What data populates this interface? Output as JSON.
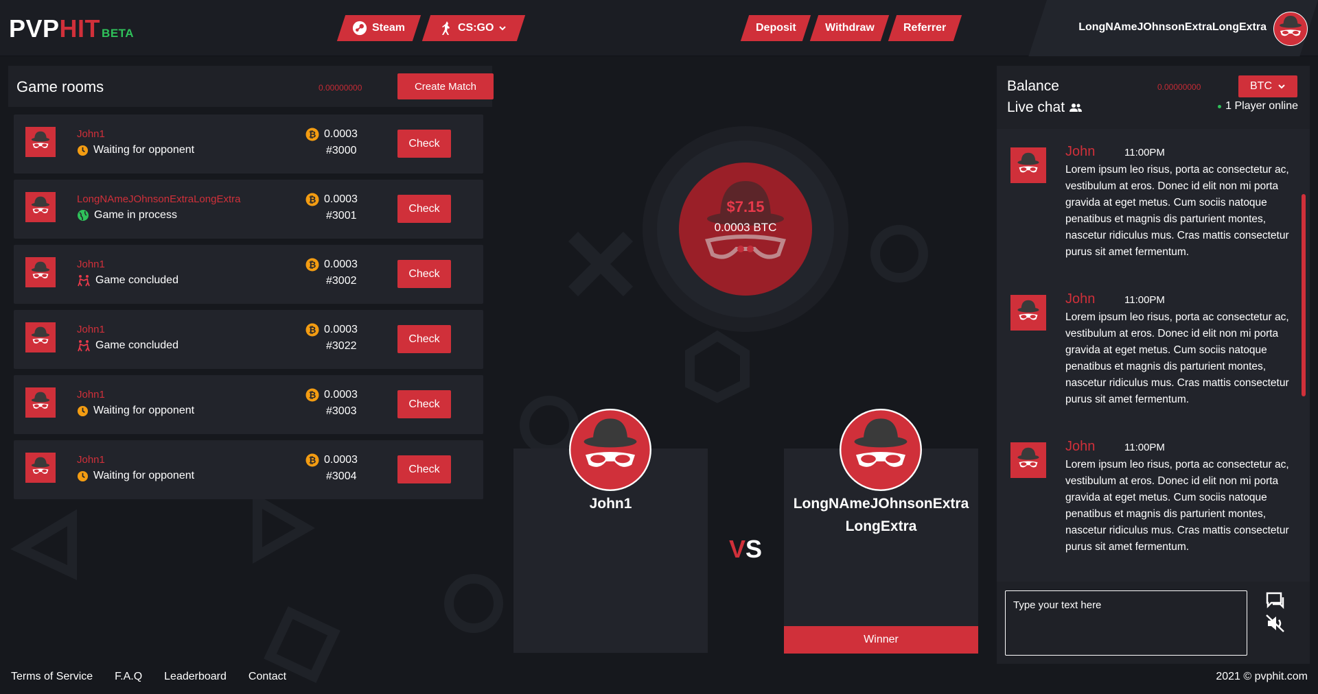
{
  "brand": {
    "pvp": "PVP",
    "hit": "HIT",
    "beta": "BETA"
  },
  "nav": {
    "steam": "Steam",
    "game": "CS:GO",
    "deposit": "Deposit",
    "withdraw": "Withdraw",
    "referrer": "Referrer"
  },
  "user": {
    "name": "LongNAmeJOhnsonExtraLongExtra"
  },
  "rooms": {
    "title": "Game rooms",
    "balance": "0.00000000",
    "create_label": "Create Match",
    "check_label": "Check",
    "items": [
      {
        "name": "John1",
        "status": "Waiting for opponent",
        "status_icon": "clock-icon",
        "amount": "0.0003",
        "id": "#3000"
      },
      {
        "name": "LongNAmeJOhnsonExtraLongExtra",
        "status": "Game in process",
        "status_icon": "globe-icon",
        "amount": "0.0003",
        "id": "#3001"
      },
      {
        "name": "John1",
        "status": "Game concluded",
        "status_icon": "fight-icon",
        "amount": "0.0003",
        "id": "#3002"
      },
      {
        "name": "John1",
        "status": "Game concluded",
        "status_icon": "fight-icon",
        "amount": "0.0003",
        "id": "#3022"
      },
      {
        "name": "John1",
        "status": "Waiting for opponent",
        "status_icon": "clock-icon",
        "amount": "0.0003",
        "id": "#3003"
      },
      {
        "name": "John1",
        "status": "Waiting for opponent",
        "status_icon": "clock-icon",
        "amount": "0.0003",
        "id": "#3004"
      }
    ]
  },
  "arena": {
    "pot_usd": "$7.15",
    "pot_btc": "0.0003 BTC",
    "player1": "John1",
    "player2": "LongNAmeJOhnsonExtraLongExtra",
    "vs_v": "V",
    "vs_s": "S",
    "winner_label": "Winner"
  },
  "sidebar": {
    "balance_label": "Balance",
    "balance_value": "0.00000000",
    "currency": "BTC",
    "livechat_label": "Live chat",
    "online_text": "1 Player online",
    "input_placeholder": "Type your text here",
    "messages": [
      {
        "name": "John",
        "time": "11:00PM",
        "text": "Lorem ipsum leo risus, porta ac consectetur ac, vestibulum at eros. Donec id elit non mi porta gravida at eget metus. Cum sociis natoque penatibus et magnis dis parturient montes, nascetur ridiculus mus. Cras mattis consectetur purus sit amet fermentum."
      },
      {
        "name": "John",
        "time": "11:00PM",
        "text": "Lorem ipsum leo risus, porta ac consectetur ac, vestibulum at eros. Donec id elit non mi porta gravida at eget metus. Cum sociis natoque penatibus et magnis dis parturient montes, nascetur ridiculus mus. Cras mattis consectetur purus sit amet fermentum."
      },
      {
        "name": "John",
        "time": "11:00PM",
        "text": "Lorem ipsum leo risus, porta ac consectetur ac, vestibulum at eros. Donec id elit non mi porta gravida at eget metus. Cum sociis natoque penatibus et magnis dis parturient montes, nascetur ridiculus mus. Cras mattis consectetur purus sit amet fermentum."
      }
    ]
  },
  "footer": {
    "terms": "Terms of Service",
    "faq": "F.A.Q",
    "leaderboard": "Leaderboard",
    "contact": "Contact",
    "copyright": "2021 © pvphit.com"
  },
  "colors": {
    "accent": "#d0303a",
    "background": "#16181d",
    "panel": "#22242b",
    "online": "#2fc15a",
    "coin": "#f39c12"
  }
}
